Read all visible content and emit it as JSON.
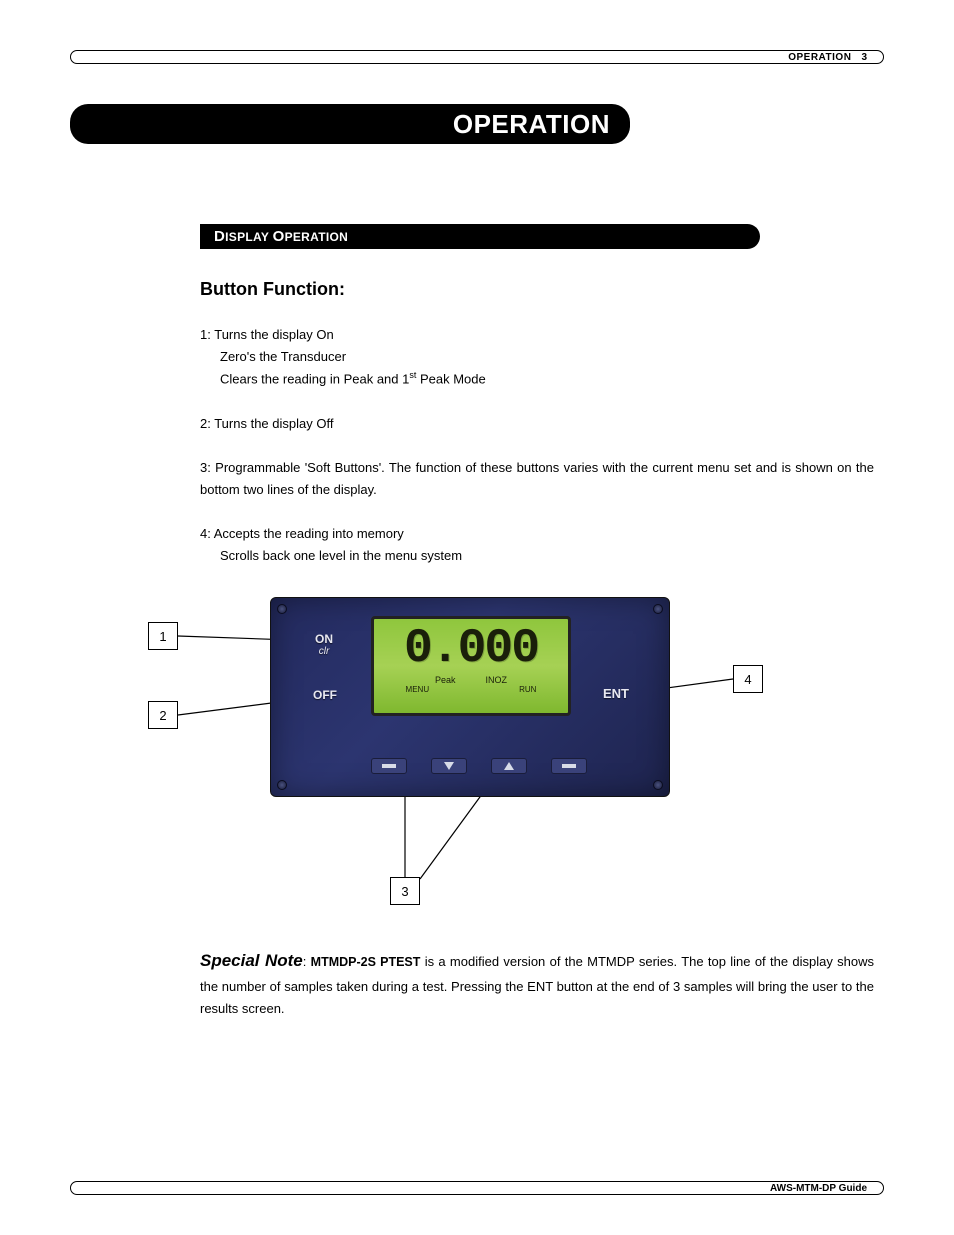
{
  "header": {
    "label": "OPERATION",
    "page": "3"
  },
  "chapter_title": "OPERATION",
  "section_title_prefix": "D",
  "section_title_mid": "ISPLAY ",
  "section_title_prefix2": "O",
  "section_title_rest": "PERATION",
  "subhead": "Button Function:",
  "functions": {
    "f1_num": "1:",
    "f1_l1": "Turns the display On",
    "f1_l2": "Zero's the Transducer",
    "f1_l3a": "Clears the reading in Peak and 1",
    "f1_l3_sup": "st",
    "f1_l3b": " Peak Mode",
    "f2_num": "2:",
    "f2_l1": " Turns the display Off",
    "f3_num": "3:",
    "f3_text": " Programmable 'Soft Buttons'.  The function of these buttons varies with the current menu set and is shown on the bottom two lines of the display.",
    "f4_num": "4:",
    "f4_l1": "Accepts the reading into memory",
    "f4_l2": "Scrolls back one level in the menu system"
  },
  "callouts": {
    "c1": "1",
    "c2": "2",
    "c3": "3",
    "c4": "4"
  },
  "device": {
    "on": "ON",
    "on_sub": "clr",
    "off": "OFF",
    "ent": "ENT",
    "digits": "0.000",
    "row2a": "Peak",
    "row2b": "INOZ",
    "row3a": "MENU",
    "row3b": "RUN"
  },
  "note": {
    "lead": "Special Note",
    "colon": ": ",
    "model": "MTMDP-2S PTEST",
    "text": " is a modified version of the MTMDP series.  The top line of the display shows the number of samples taken during a test.  Pressing the ENT button at the end of 3 samples will bring the user to the results screen."
  },
  "footer": {
    "text": "AWS-MTM-DP Guide"
  }
}
